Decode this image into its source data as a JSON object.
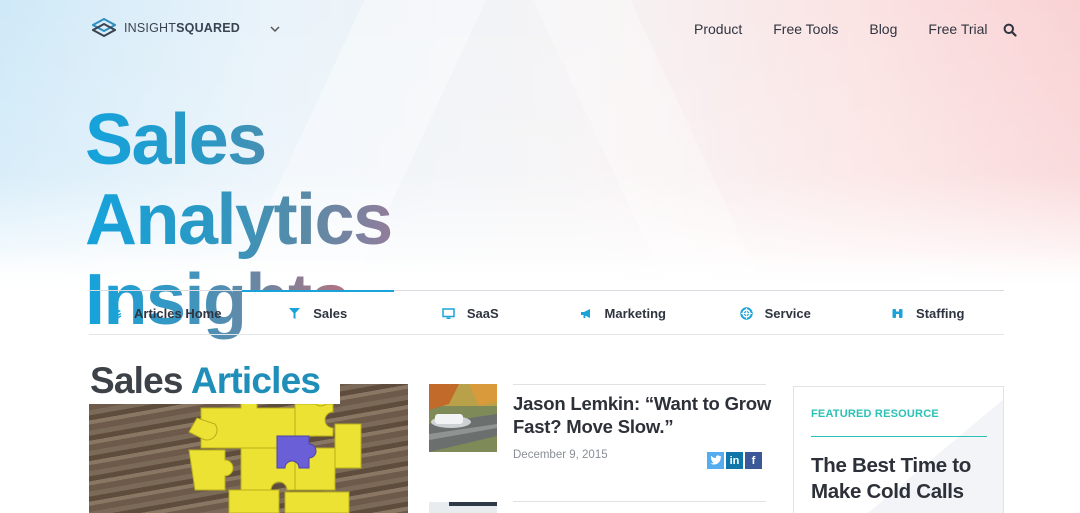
{
  "header": {
    "logo_text_light": "INSIGHT",
    "logo_text_bold": "SQUARED",
    "nav": [
      {
        "label": "Product"
      },
      {
        "label": "Free Tools"
      },
      {
        "label": "Blog"
      },
      {
        "label": "Free Trial"
      }
    ]
  },
  "hero": {
    "line1": "Sales Analytics",
    "line2": "Insights."
  },
  "tabs": [
    {
      "label": "Articles Home",
      "icon": "layers-icon"
    },
    {
      "label": "Sales",
      "icon": "funnel-icon",
      "active": true
    },
    {
      "label": "SaaS",
      "icon": "monitor-icon"
    },
    {
      "label": "Marketing",
      "icon": "megaphone-icon"
    },
    {
      "label": "Service",
      "icon": "lifebuoy-icon"
    },
    {
      "label": "Staffing",
      "icon": "binoculars-icon"
    }
  ],
  "section": {
    "title_part1": "Sales",
    "title_part2": "Articles"
  },
  "articles": [
    {
      "title": "Jason Lemkin: “Want to Grow Fast? Move Slow.”",
      "date": "December 9, 2015"
    }
  ],
  "resource": {
    "label": "FEATURED RESOURCE",
    "title": "The Best Time to Make Cold Calls"
  },
  "colors": {
    "accent": "#1aa3d8",
    "teal": "#2bc1b5",
    "twitter": "#55acee",
    "linkedin": "#0e76a8",
    "facebook": "#3b5998"
  }
}
